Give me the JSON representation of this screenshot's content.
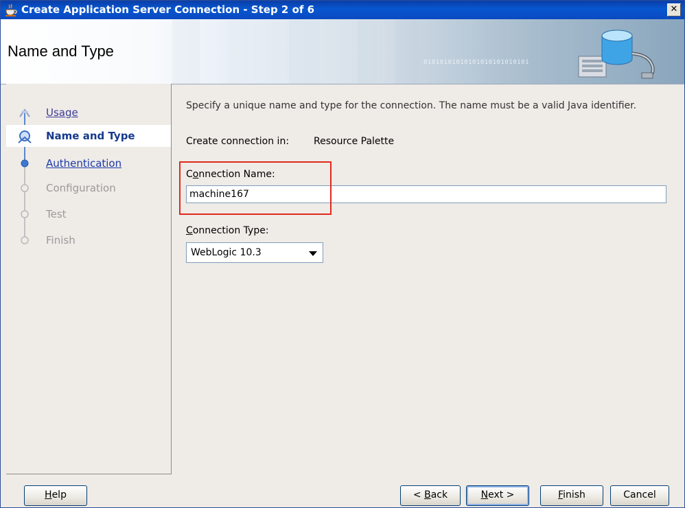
{
  "window": {
    "title": "Create Application Server Connection - Step 2 of 6",
    "close_symbol": "✕"
  },
  "header": {
    "title": "Name and Type",
    "decor_binary": "01010101010101010101010101"
  },
  "nav": {
    "items": [
      {
        "label": "Usage",
        "state": "done"
      },
      {
        "label": "Name and Type",
        "state": "current"
      },
      {
        "label": "Authentication",
        "state": "link"
      },
      {
        "label": "Configuration",
        "state": "disabled"
      },
      {
        "label": "Test",
        "state": "disabled"
      },
      {
        "label": "Finish",
        "state": "disabled"
      }
    ]
  },
  "content": {
    "instructions": "Specify a unique name and type for the connection. The name must be a valid Java identifier.",
    "create_in_label": "Create connection in:",
    "create_in_value": "Resource Palette",
    "connection_name_label_pre": "C",
    "connection_name_label_mnemonic": "o",
    "connection_name_label_post": "nnection Name:",
    "connection_name_value": "machine167",
    "connection_type_label_mnemonic": "C",
    "connection_type_label_post": "onnection Type:",
    "connection_type_value": "WebLogic 10.3"
  },
  "buttons": {
    "help_mnemonic": "H",
    "help_rest": "elp",
    "back_pre": "< ",
    "back_mnemonic": "B",
    "back_rest": "ack",
    "next_mnemonic": "N",
    "next_rest": "ext >",
    "finish_mnemonic": "F",
    "finish_rest": "inish",
    "cancel": "Cancel"
  },
  "colors": {
    "titlebar": "#0856d0",
    "highlight_box": "#e0291b",
    "nav_current_text": "#163a8e"
  }
}
